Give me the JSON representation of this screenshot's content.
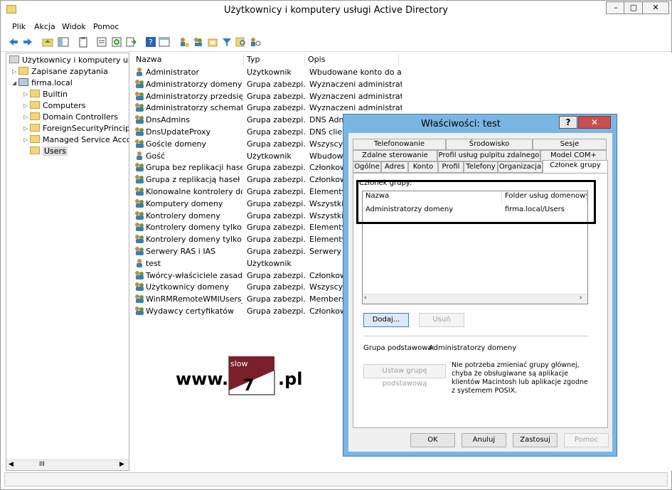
{
  "window": {
    "title": "Użytkownicy i komputery usługi Active Directory",
    "minimize": "–",
    "maximize": "▢",
    "close": "✕"
  },
  "menu": [
    "Plik",
    "Akcja",
    "Widok",
    "Pomoc"
  ],
  "tree": {
    "root": "Użytkownicy i komputery usługi",
    "saved": "Zapisane zapytania",
    "domain": "firma.local",
    "children": [
      "Builtin",
      "Computers",
      "Domain Controllers",
      "ForeignSecurityPrincipals",
      "Managed Service Accour",
      "Users"
    ],
    "scroll_label": "III"
  },
  "list": {
    "columns": [
      "Nazwa",
      "Typ",
      "Opis"
    ],
    "rows": [
      {
        "name": "Administrator",
        "type": "Użytkownik",
        "desc": "Wbudowane konto do a...",
        "kind": "user"
      },
      {
        "name": "Administratorzy domeny",
        "type": "Grupa zabezpi...",
        "desc": "Wyznaczeni administrat...",
        "kind": "group"
      },
      {
        "name": "Administratorzy przedsiębi...",
        "type": "Grupa zabezpi...",
        "desc": "Wyznaczeni administrat...",
        "kind": "group"
      },
      {
        "name": "Administratorzy schematu",
        "type": "Grupa zabezpi...",
        "desc": "Wyznaczeni administrat...",
        "kind": "group"
      },
      {
        "name": "DnsAdmins",
        "type": "Grupa zabezpi...",
        "desc": "DNS Admi",
        "kind": "group"
      },
      {
        "name": "DnsUpdateProxy",
        "type": "Grupa zabezpi...",
        "desc": "DNS client",
        "kind": "group"
      },
      {
        "name": "Goście domeny",
        "type": "Grupa zabezpi...",
        "desc": "Wszyscy g",
        "kind": "group"
      },
      {
        "name": "Gość",
        "type": "Użytkownik",
        "desc": "Wbudowa",
        "kind": "user"
      },
      {
        "name": "Grupa bez replikacji haseł ...",
        "type": "Grupa zabezpi...",
        "desc": "Członkowi",
        "kind": "group"
      },
      {
        "name": "Grupa z replikacją haseł na ...",
        "type": "Grupa zabezpi...",
        "desc": "Członkowi",
        "kind": "group"
      },
      {
        "name": "Klonowalne kontrolery do...",
        "type": "Grupa zabezpi...",
        "desc": "Elementy",
        "kind": "group"
      },
      {
        "name": "Komputery domeny",
        "type": "Grupa zabezpi...",
        "desc": "Wszystkie",
        "kind": "group"
      },
      {
        "name": "Kontrolery domeny",
        "type": "Grupa zabezpi...",
        "desc": "Wszystkie",
        "kind": "group"
      },
      {
        "name": "Kontrolery domeny tylko d...",
        "type": "Grupa zabezpi...",
        "desc": "Elementy",
        "kind": "group"
      },
      {
        "name": "Kontrolery domeny tylko d...",
        "type": "Grupa zabezpi...",
        "desc": "Elementy",
        "kind": "group"
      },
      {
        "name": "Serwery RAS i IAS",
        "type": "Grupa zabezpi...",
        "desc": "Serwery w",
        "kind": "group"
      },
      {
        "name": "test",
        "type": "Użytkownik",
        "desc": "",
        "kind": "user"
      },
      {
        "name": "Twórcy-właściciele zasad g...",
        "type": "Grupa zabezpi...",
        "desc": "Członkowi",
        "kind": "group"
      },
      {
        "name": "Użytkownicy domeny",
        "type": "Grupa zabezpi...",
        "desc": "Wszyscy u",
        "kind": "group"
      },
      {
        "name": "WinRMRemoteWMIUsers__",
        "type": "Grupa zabezpi...",
        "desc": "Members",
        "kind": "group"
      },
      {
        "name": "Wydawcy certyfikatów",
        "type": "Grupa zabezpi...",
        "desc": "Członkowi",
        "kind": "group"
      }
    ]
  },
  "watermark": {
    "prefix": "www.",
    "logo_top": "slow",
    "logo_num": "7",
    "suffix": ".pl"
  },
  "dialog": {
    "title": "Właściwości: test",
    "help": "?",
    "close": "✕",
    "tabs_row1": [
      "Telefonowanie",
      "Środowisko",
      "Sesje"
    ],
    "tabs_row2": [
      "Zdalne sterowanie",
      "Profil usług pulpitu zdalnego",
      "Model COM+"
    ],
    "tabs_row3": [
      "Ogólne",
      "Adres",
      "Konto",
      "Profil",
      "Telefony",
      "Organizacja",
      "Członek grupy"
    ],
    "member_label": "Członek grupy:",
    "lv_columns": [
      "Nazwa",
      "Folder usług domenowych"
    ],
    "lv_rows": [
      {
        "name": "Administratorzy domeny",
        "folder": "firma.local/Users"
      }
    ],
    "add": "Dodaj...",
    "remove": "Usuń",
    "primary_label": "Grupa podstawowa:",
    "primary_value": "Administratorzy domeny",
    "set_primary": "Ustaw grupę podstawową",
    "note": "Nie potrzeba zmieniać grupy głównej, chyba że obsługiwane są aplikacje klientów Macintosh lub aplikacje zgodne z systemem POSIX.",
    "ok": "OK",
    "cancel": "Anuluj",
    "apply": "Zastosuj",
    "help_btn": "Pomoc"
  }
}
